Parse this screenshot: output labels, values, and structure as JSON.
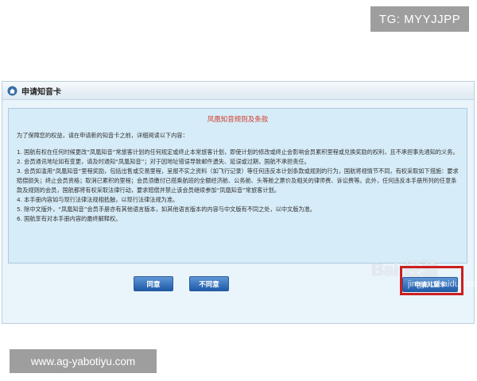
{
  "watermark_top": "TG: MYYJJPP",
  "watermark_bottom": "www.ag-yabotiyu.com",
  "watermark_baidu": "Bai 经验",
  "watermark_jingyan": "jingyan.baidu.com",
  "panel": {
    "icon": "home-icon",
    "title": "申请知音卡"
  },
  "terms": {
    "title": "凤凰知音规则及条款",
    "intro": "为了保障您的权益，请在申请新的知音卡之前，详细阅读以下内容：",
    "items": [
      "1. 国航有权在任何时候更改“凤凰知音”常旅客计划的任何规定或终止本常旅客计划，即使计划的修改或终止会影响会员累积里程或兑换奖励的权利，且不承担事先通知的义务。",
      "2. 会员通讯地址如有变更，请及时通知“凤凰知音”；对于因地址错误导致邮件遗失、延误或过期，国航不承担责任。",
      "3. 会员如滥用“凤凰知音”里程奖励，包括出售或交易里程，呈报不实之资料（如飞行记录）等任何违反本计划条款或规则的行为，国航将视情节不同，有权采取如下措施：要求赔偿损失；终止会员资格；取消已累积的里程；会员须缴付已搭乘航班的全额经济舱、公务舱、头等舱之票价及相关的律师费、诉讼费等。此外，任何违反本手册所列的任意条款及规则的会员，国航都将有权采取法律行动，要求赔偿并禁止该会员继续参加“凤凰知音”常旅客计划。",
      "4. 本手册内容如与现行法律法规相抵触，以现行法律法规为准。",
      "5. 除中文版外，“凤凰知音”会员手册亦有其他语言版本，如其他语言版本的内容与中文版有不同之处，以中文版为准。",
      "6. 国航享有对本手册内容的最终解释权。"
    ]
  },
  "buttons": {
    "agree": "同意",
    "disagree": "不同意",
    "apply": "申请儿童卡"
  },
  "colors": {
    "terms_title": "#d23c2c",
    "button": "#1f5aa8",
    "highlight": "#cc1f1f"
  }
}
